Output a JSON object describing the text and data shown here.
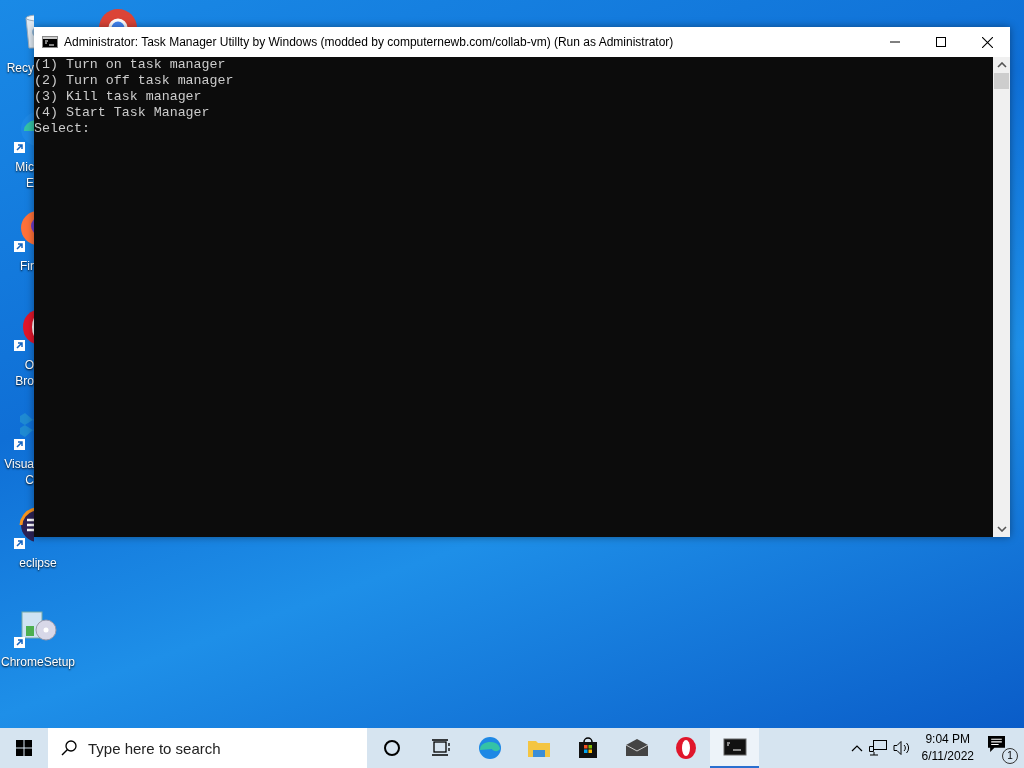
{
  "desktop_icons": [
    {
      "kind": "recycle-bin",
      "label_lines": [
        "Recy"
      ]
    },
    {
      "kind": "edge",
      "label_lines": [
        "Mic",
        "E"
      ]
    },
    {
      "kind": "firefox",
      "label_lines": [
        "Fir"
      ]
    },
    {
      "kind": "opera",
      "label_lines": [
        "O",
        "Bro"
      ]
    },
    {
      "kind": "vscode",
      "label_lines": [
        "Visua",
        "C"
      ]
    },
    {
      "kind": "eclipse",
      "label_lines": [
        "eclipse"
      ]
    },
    {
      "kind": "setup",
      "label_lines": [
        "ChromeSetup"
      ]
    }
  ],
  "window": {
    "title": "Administrator:  Task Manager Utillty by Windows (modded by computernewb.com/collab-vm) (Run as Administrator)",
    "console_lines": [
      "(1) Turn on task manager",
      "(2) Turn off task manager",
      "(3) Kill task manager",
      "(4) Start Task Manager",
      "Select:"
    ]
  },
  "taskbar": {
    "search": {
      "placeholder": "Type here to search"
    },
    "apps": [
      {
        "kind": "cortana",
        "selected": false
      },
      {
        "kind": "taskview",
        "selected": false
      },
      {
        "kind": "edge",
        "selected": false
      },
      {
        "kind": "explorer",
        "selected": false
      },
      {
        "kind": "store",
        "selected": false
      },
      {
        "kind": "mail",
        "selected": false
      },
      {
        "kind": "opera",
        "selected": false
      },
      {
        "kind": "console",
        "selected": true
      }
    ],
    "clock": {
      "time": "9:04 PM",
      "date": "6/11/2022"
    },
    "notification_count": "1"
  }
}
